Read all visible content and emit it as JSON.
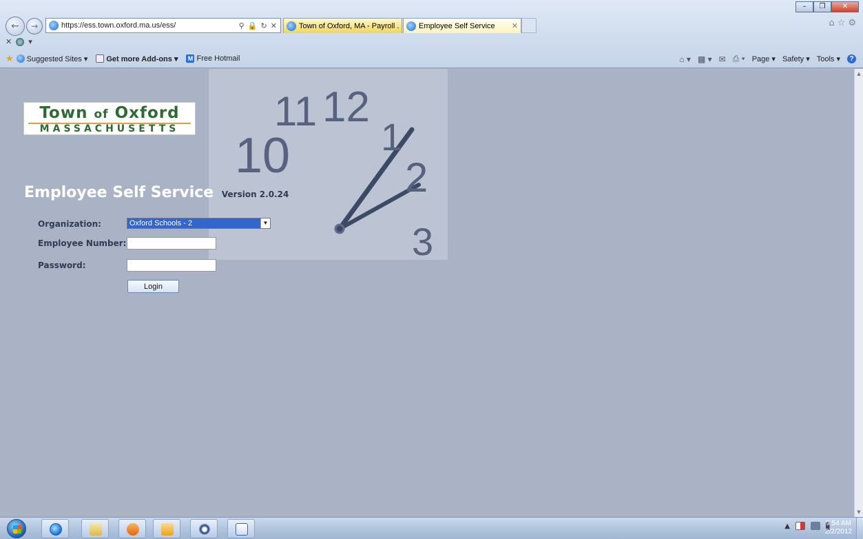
{
  "browser": {
    "address_url": "https://ess.town.oxford.ma.us/ess/",
    "tabs": [
      {
        "label": "Town of Oxford, MA - Payroll ...",
        "active": false
      },
      {
        "label": "Employee Self Service",
        "active": true
      }
    ],
    "favorites_bar": {
      "suggested_sites": "Suggested Sites ▾",
      "get_addons": "Get more Add-ons ▾",
      "free_hotmail": "Free Hotmail"
    },
    "command_bar": {
      "page": "Page ▾",
      "safety": "Safety ▾",
      "tools": "Tools ▾"
    }
  },
  "page": {
    "logo": {
      "town": "Town",
      "of": "of",
      "oxford": "Oxford",
      "state": "MASSACHUSETTS"
    },
    "title": "Employee Self Service",
    "version": "Version 2.0.24",
    "form": {
      "organization_label": "Organization:",
      "organization_value": "Oxford Schools - 2",
      "employee_number_label": "Employee Number:",
      "employee_number_value": "",
      "password_label": "Password:",
      "password_value": "",
      "login_label": "Login"
    },
    "clock_numerals": [
      "10",
      "11",
      "12",
      "1",
      "2",
      "3"
    ]
  },
  "taskbar": {
    "time": "9:54 AM",
    "date": "2/2/2012",
    "pinned": [
      "internet-explorer",
      "windows-explorer",
      "media-player",
      "outlook",
      "navigator",
      "word"
    ]
  },
  "colors": {
    "page_background": "#aab3c6",
    "logo_green": "#2e6a33",
    "logo_rule": "#d8a24a",
    "select_highlight": "#3366cc",
    "label_text": "#2f3b52"
  }
}
